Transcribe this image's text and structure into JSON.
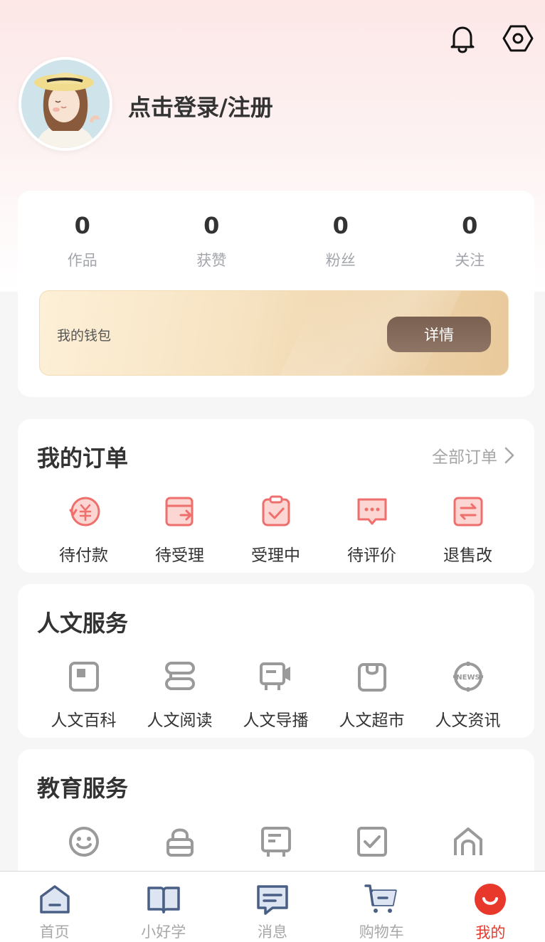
{
  "header": {
    "login_text": "点击登录/注册"
  },
  "stats": [
    {
      "value": "0",
      "label": "作品"
    },
    {
      "value": "0",
      "label": "获赞"
    },
    {
      "value": "0",
      "label": "粉丝"
    },
    {
      "value": "0",
      "label": "关注"
    }
  ],
  "wallet": {
    "label": "我的钱包",
    "button": "详情"
  },
  "orders": {
    "title": "我的订单",
    "link": "全部订单",
    "items": [
      {
        "label": "待付款",
        "icon": "payment-pending-icon"
      },
      {
        "label": "待受理",
        "icon": "pending-acceptance-icon"
      },
      {
        "label": "受理中",
        "icon": "processing-icon"
      },
      {
        "label": "待评价",
        "icon": "review-pending-icon"
      },
      {
        "label": "退售改",
        "icon": "refund-exchange-icon"
      }
    ]
  },
  "humanities": {
    "title": "人文服务",
    "items": [
      {
        "label": "人文百科",
        "icon": "encyclopedia-icon"
      },
      {
        "label": "人文阅读",
        "icon": "reading-icon"
      },
      {
        "label": "人文导播",
        "icon": "broadcast-icon"
      },
      {
        "label": "人文超市",
        "icon": "shopping-bag-icon"
      },
      {
        "label": "人文资讯",
        "icon": "news-icon"
      }
    ]
  },
  "education": {
    "title": "教育服务",
    "items": [
      {
        "icon": "smiley-icon"
      },
      {
        "icon": "lock-icon"
      },
      {
        "icon": "board-icon"
      },
      {
        "icon": "checkbox-icon"
      },
      {
        "icon": "home-icon"
      }
    ]
  },
  "tabbar": [
    {
      "label": "首页",
      "icon": "home-tab-icon"
    },
    {
      "label": "小好学",
      "icon": "book-tab-icon"
    },
    {
      "label": "消息",
      "icon": "message-tab-icon"
    },
    {
      "label": "购物车",
      "icon": "cart-tab-icon"
    },
    {
      "label": "我的",
      "icon": "profile-tab-icon",
      "active": true
    }
  ],
  "colors": {
    "accent": "#e8382c",
    "order_icon": "#ef6f6c",
    "service_icon": "#9a9a9a",
    "tab_icon": "#4a5f85"
  }
}
